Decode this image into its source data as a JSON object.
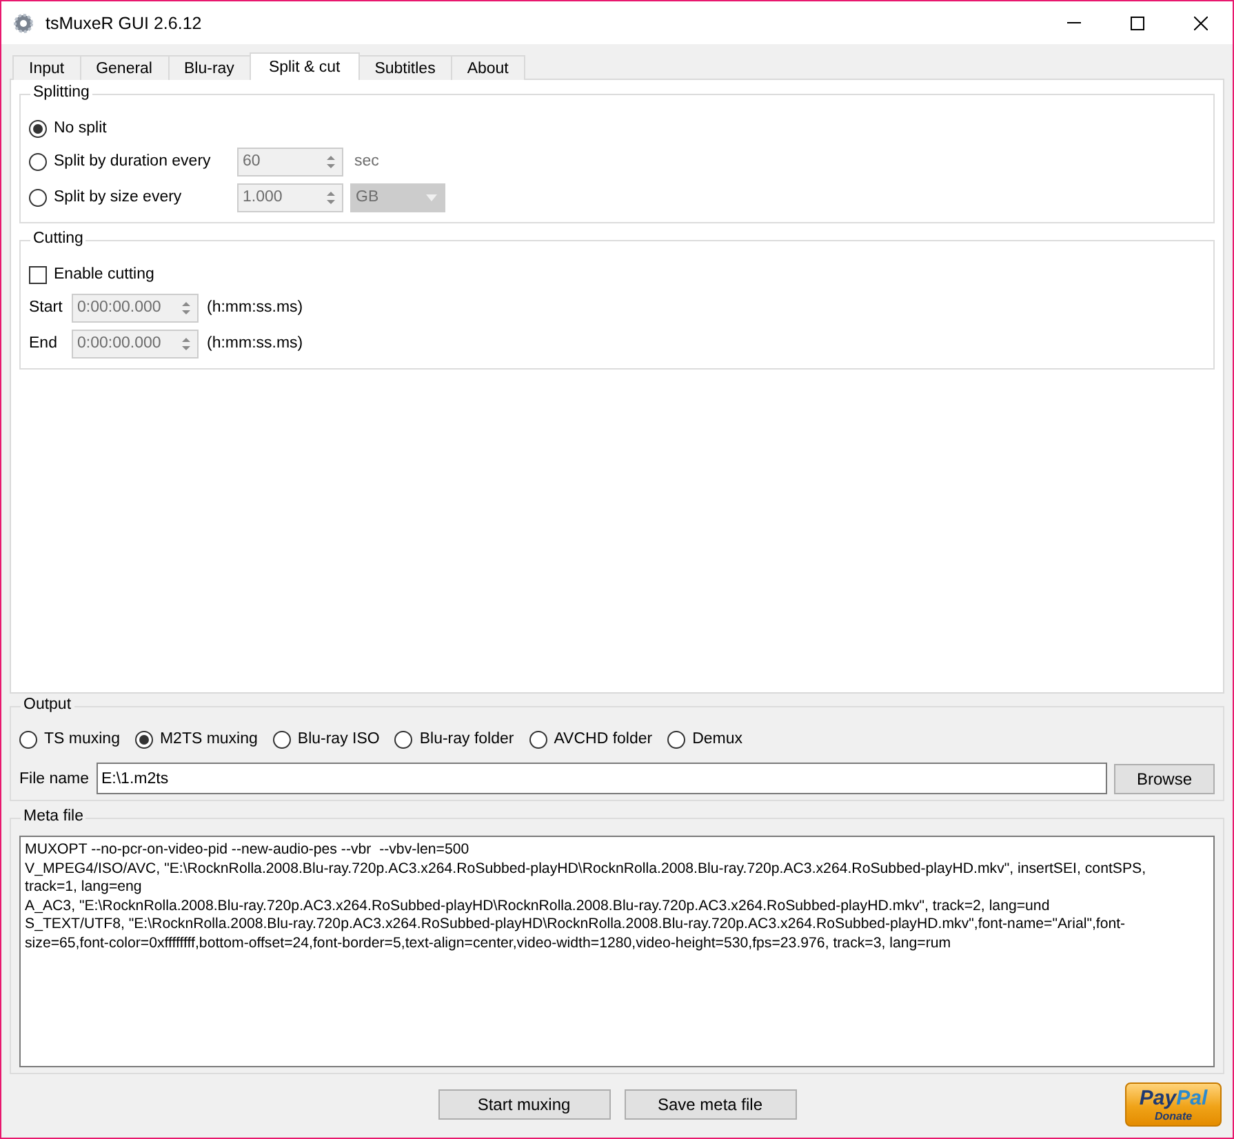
{
  "window": {
    "title": "tsMuxeR GUI 2.6.12"
  },
  "tabs": [
    {
      "label": "Input",
      "selected": false
    },
    {
      "label": "General",
      "selected": false
    },
    {
      "label": "Blu-ray",
      "selected": false
    },
    {
      "label": "Split & cut",
      "selected": true
    },
    {
      "label": "Subtitles",
      "selected": false
    },
    {
      "label": "About",
      "selected": false
    }
  ],
  "splitting": {
    "title": "Splitting",
    "options": [
      {
        "kind": "plain",
        "label": "No split",
        "selected": true
      },
      {
        "kind": "spin",
        "label": "Split by duration every",
        "selected": false,
        "value": "60",
        "unit": "sec"
      },
      {
        "kind": "spin_combo",
        "label": "Split by size every",
        "selected": false,
        "value": "1.000",
        "unit": "GB"
      }
    ]
  },
  "cutting": {
    "title": "Cutting",
    "enable": {
      "label": "Enable cutting",
      "checked": false
    },
    "fields": [
      {
        "label": "Start",
        "value": "0:00:00.000",
        "hint": "(h:mm:ss.ms)"
      },
      {
        "label": "End",
        "value": "0:00:00.000",
        "hint": "(h:mm:ss.ms)"
      }
    ]
  },
  "output": {
    "title": "Output",
    "modes": [
      {
        "label": "TS muxing",
        "selected": false
      },
      {
        "label": "M2TS muxing",
        "selected": true
      },
      {
        "label": "Blu-ray ISO",
        "selected": false
      },
      {
        "label": "Blu-ray folder",
        "selected": false
      },
      {
        "label": "AVCHD folder",
        "selected": false
      },
      {
        "label": "Demux",
        "selected": false
      }
    ],
    "file_label": "File name",
    "file_value": "E:\\1.m2ts",
    "browse": "Browse"
  },
  "meta": {
    "title": "Meta file",
    "lines": [
      "MUXOPT --no-pcr-on-video-pid --new-audio-pes --vbr  --vbv-len=500",
      "V_MPEG4/ISO/AVC, \"E:\\RocknRolla.2008.Blu-ray.720p.AC3.x264.RoSubbed-playHD\\RocknRolla.2008.Blu-ray.720p.AC3.x264.RoSubbed-playHD.mkv\", insertSEI, contSPS,",
      "track=1, lang=eng",
      "A_AC3, \"E:\\RocknRolla.2008.Blu-ray.720p.AC3.x264.RoSubbed-playHD\\RocknRolla.2008.Blu-ray.720p.AC3.x264.RoSubbed-playHD.mkv\", track=2, lang=und",
      "S_TEXT/UTF8, \"E:\\RocknRolla.2008.Blu-ray.720p.AC3.x264.RoSubbed-playHD\\RocknRolla.2008.Blu-ray.720p.AC3.x264.RoSubbed-playHD.mkv\",font-name=\"Arial\",font-",
      "size=65,font-color=0xffffffff,bottom-offset=24,font-border=5,text-align=center,video-width=1280,video-height=530,fps=23.976, track=3, lang=rum"
    ]
  },
  "buttons": [
    "Start muxing",
    "Save meta file"
  ],
  "donate": {
    "brand_first": "Pay",
    "brand_second": "Pal",
    "caption": "Donate"
  }
}
